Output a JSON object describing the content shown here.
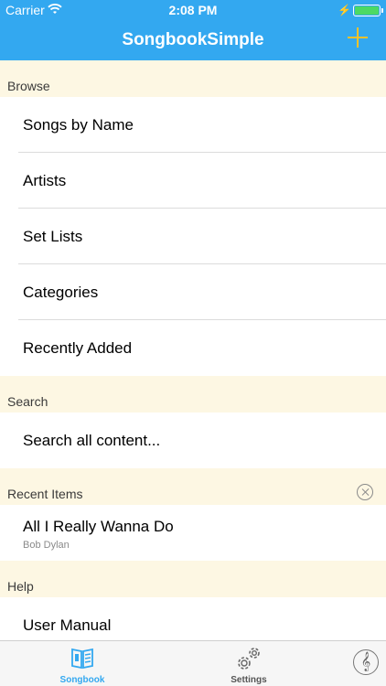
{
  "status_bar": {
    "carrier": "Carrier",
    "time": "2:08 PM"
  },
  "nav": {
    "title": "SongbookSimple",
    "add_icon": "plus-icon",
    "accent_color": "#f5c22c",
    "bar_color": "#33a8f0"
  },
  "browse": {
    "header": "Browse",
    "items": [
      {
        "label": "Songs by Name"
      },
      {
        "label": "Artists"
      },
      {
        "label": "Set Lists"
      },
      {
        "label": "Categories"
      },
      {
        "label": "Recently Added"
      }
    ]
  },
  "search": {
    "header": "Search",
    "label": "Search all content..."
  },
  "recent": {
    "header": "Recent Items",
    "clear_icon": "clear-circle-icon",
    "items": [
      {
        "title": "All I Really Wanna Do",
        "subtitle": "Bob Dylan"
      }
    ]
  },
  "help": {
    "header": "Help",
    "items": [
      {
        "label": "User Manual"
      }
    ]
  },
  "tabbar": {
    "tabs": [
      {
        "label": "Songbook",
        "icon": "book-icon",
        "selected": true
      },
      {
        "label": "Settings",
        "icon": "gears-icon",
        "selected": false
      }
    ],
    "extra_icon": "treble-clef-icon"
  }
}
